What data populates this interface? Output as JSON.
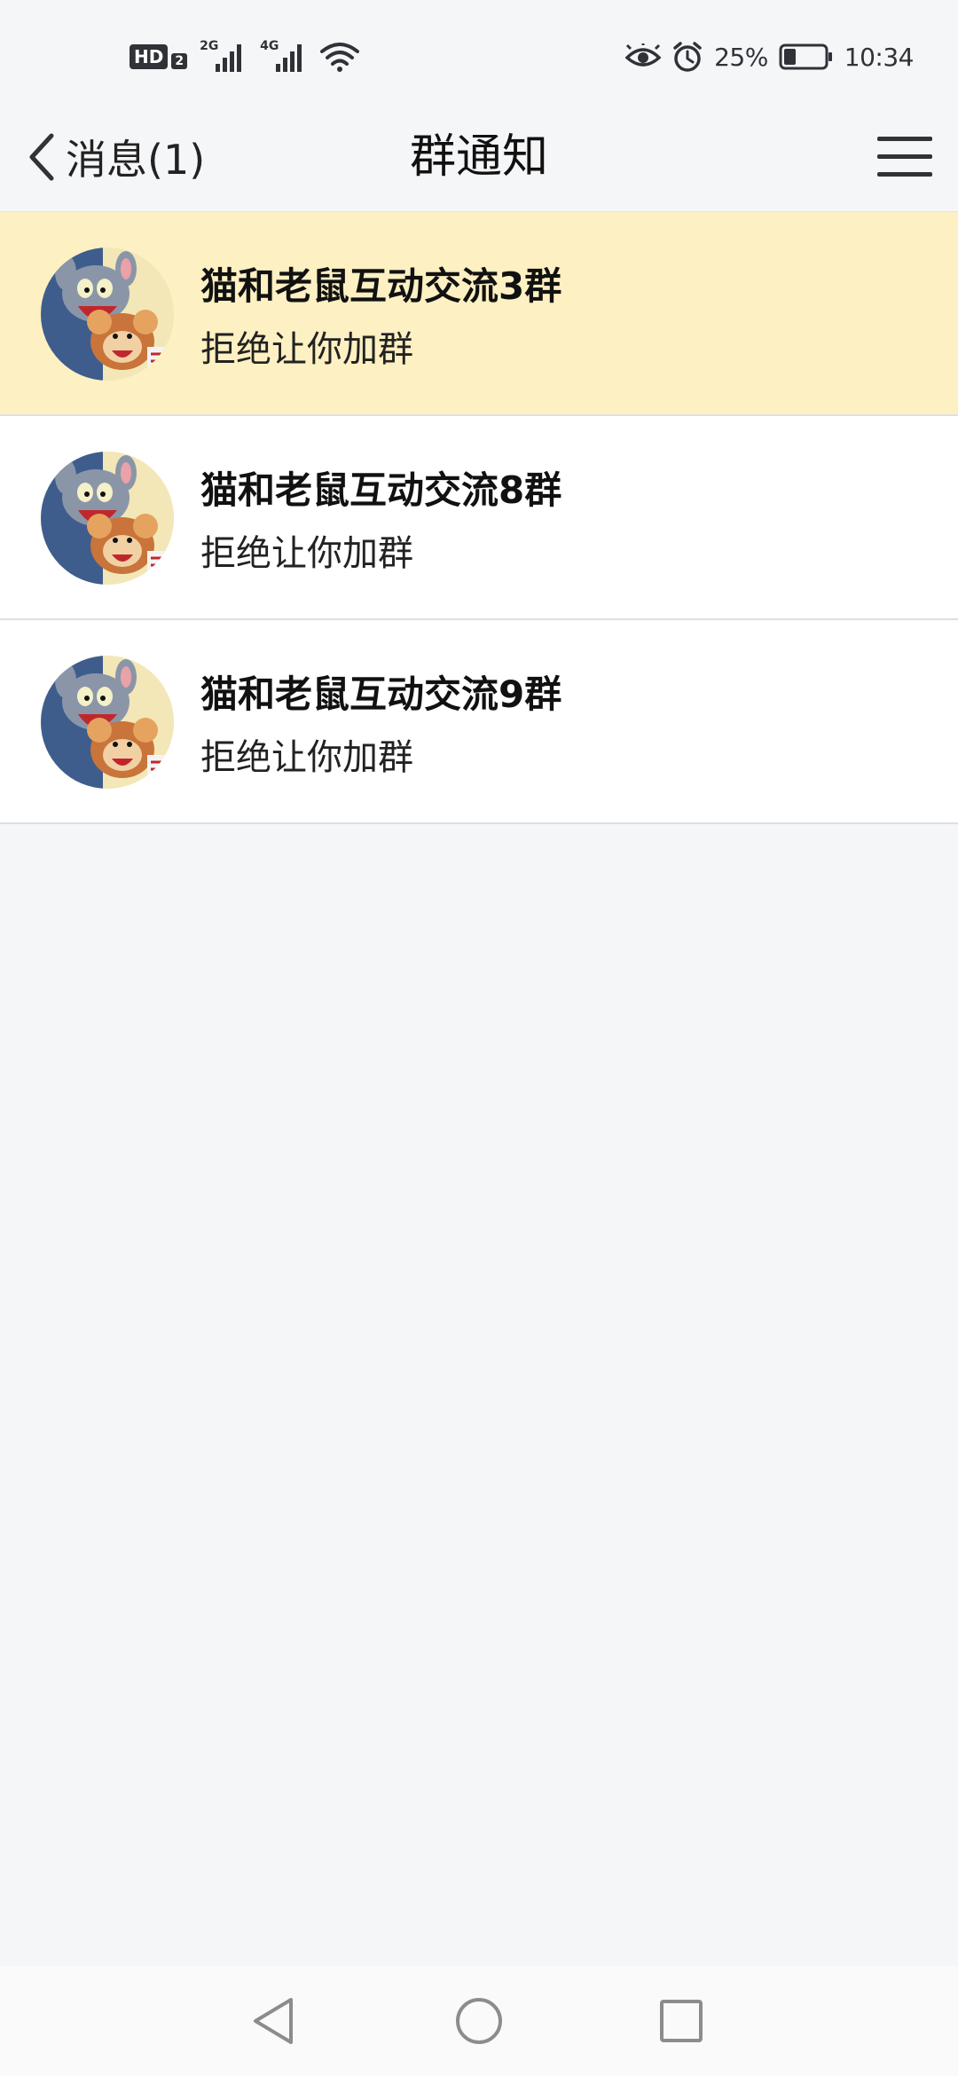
{
  "status_bar": {
    "hd_label": "HD",
    "hd_sub": "2",
    "signal1_label": "2G",
    "signal2_label": "4G",
    "battery_percent": "25%",
    "time": "10:34",
    "icons": [
      "hd-icon",
      "signal-icon",
      "wifi-icon",
      "eye-icon",
      "alarm-icon",
      "battery-icon"
    ]
  },
  "header": {
    "back_label": "消息(1)",
    "title": "群通知"
  },
  "notices": [
    {
      "title": "猫和老鼠互动交流3群",
      "status": "拒绝让你加群",
      "highlighted": true
    },
    {
      "title": "猫和老鼠互动交流8群",
      "status": "拒绝让你加群",
      "highlighted": false
    },
    {
      "title": "猫和老鼠互动交流9群",
      "status": "拒绝让你加群",
      "highlighted": false
    }
  ],
  "nav": {
    "icons": [
      "back-triangle-icon",
      "home-circle-icon",
      "recents-square-icon"
    ]
  },
  "colors": {
    "page_bg": "#f5f6f8",
    "highlight_bg": "#fdf0c2",
    "row_bg": "#ffffff",
    "text": "#111111"
  }
}
